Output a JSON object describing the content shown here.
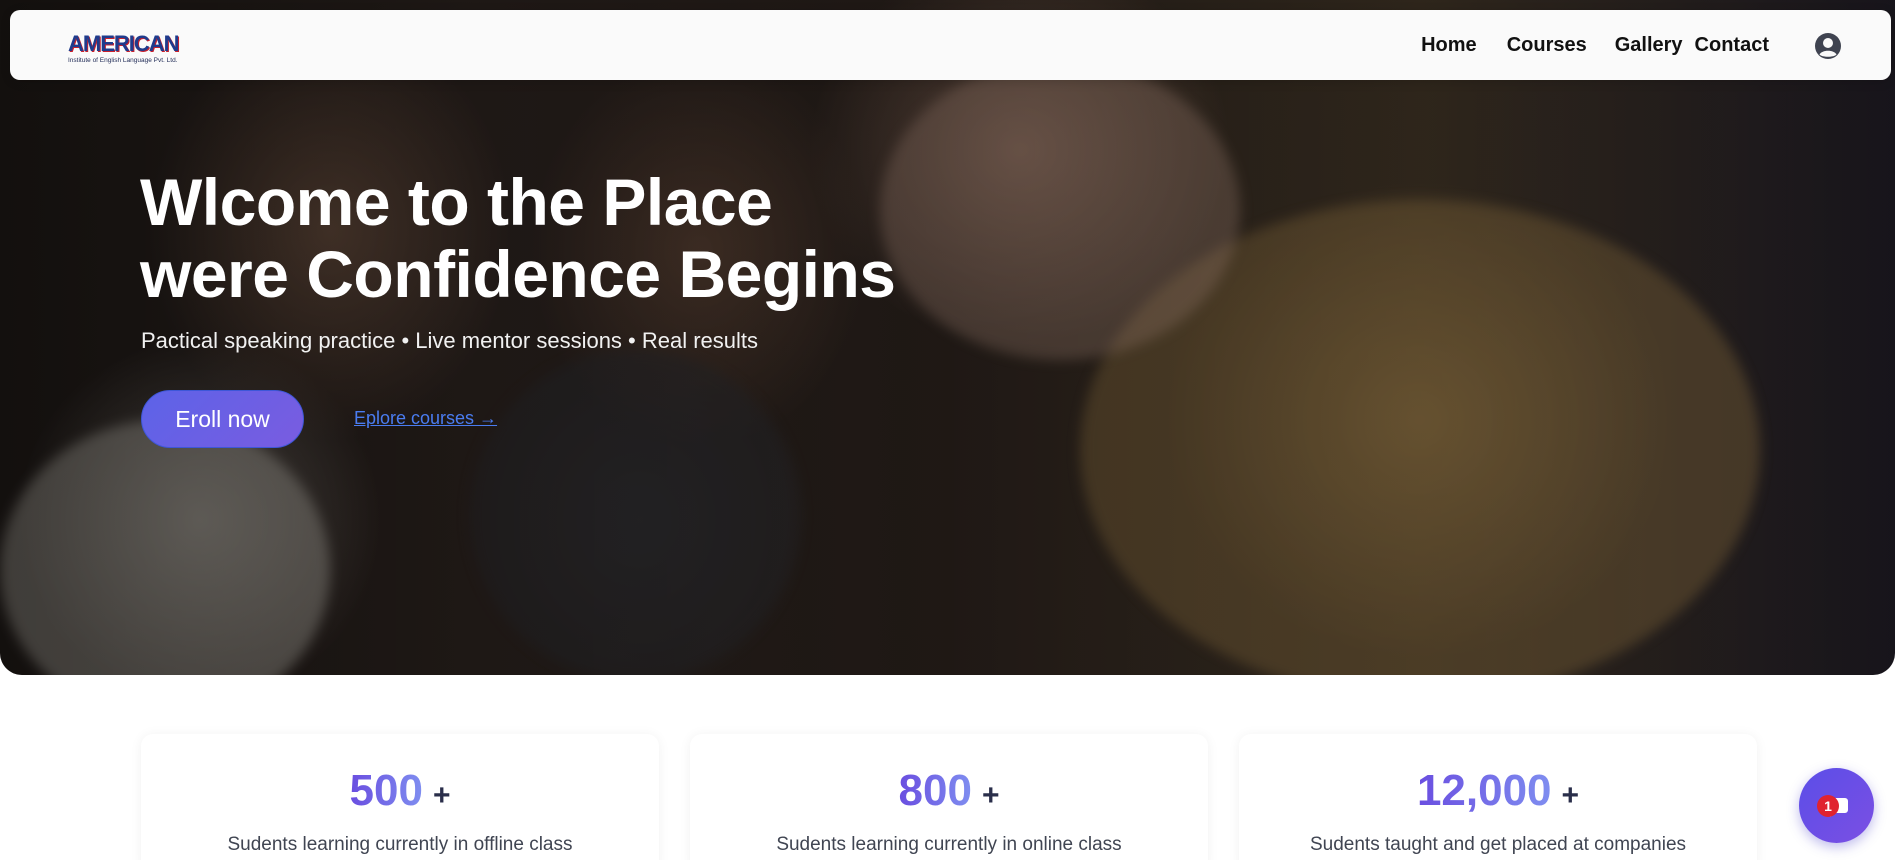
{
  "brand": {
    "logo_text": "AMERICAN",
    "logo_subtext": "Institute of English Language Pvt. Ltd."
  },
  "nav": {
    "items": [
      {
        "label": "Home"
      },
      {
        "label": "Courses"
      },
      {
        "label": "Gallery"
      },
      {
        "label": "Contact"
      }
    ],
    "user_icon": "user-circle-icon"
  },
  "hero": {
    "title_line1": "Wlcome to the Place",
    "title_line2": "were Confidence Begins",
    "subtitle": "Pactical speaking practice • Live mentor sessions • Real results",
    "primary_cta": "Eroll now",
    "secondary_cta": "Eplore courses →"
  },
  "stats": [
    {
      "number": "500",
      "suffix": "+",
      "label": "Sudents learning currently in offline class"
    },
    {
      "number": "800",
      "suffix": "+",
      "label": "Sudents learning currently in online class"
    },
    {
      "number": "12,000",
      "suffix": "+",
      "label": "Sudents taught and get placed at companies"
    }
  ],
  "chat": {
    "icon": "chat-bubble-icon",
    "badge": "1"
  },
  "colors": {
    "accent": "#6a4ee0",
    "link": "#4a7cf0",
    "badge": "#e0232f"
  }
}
